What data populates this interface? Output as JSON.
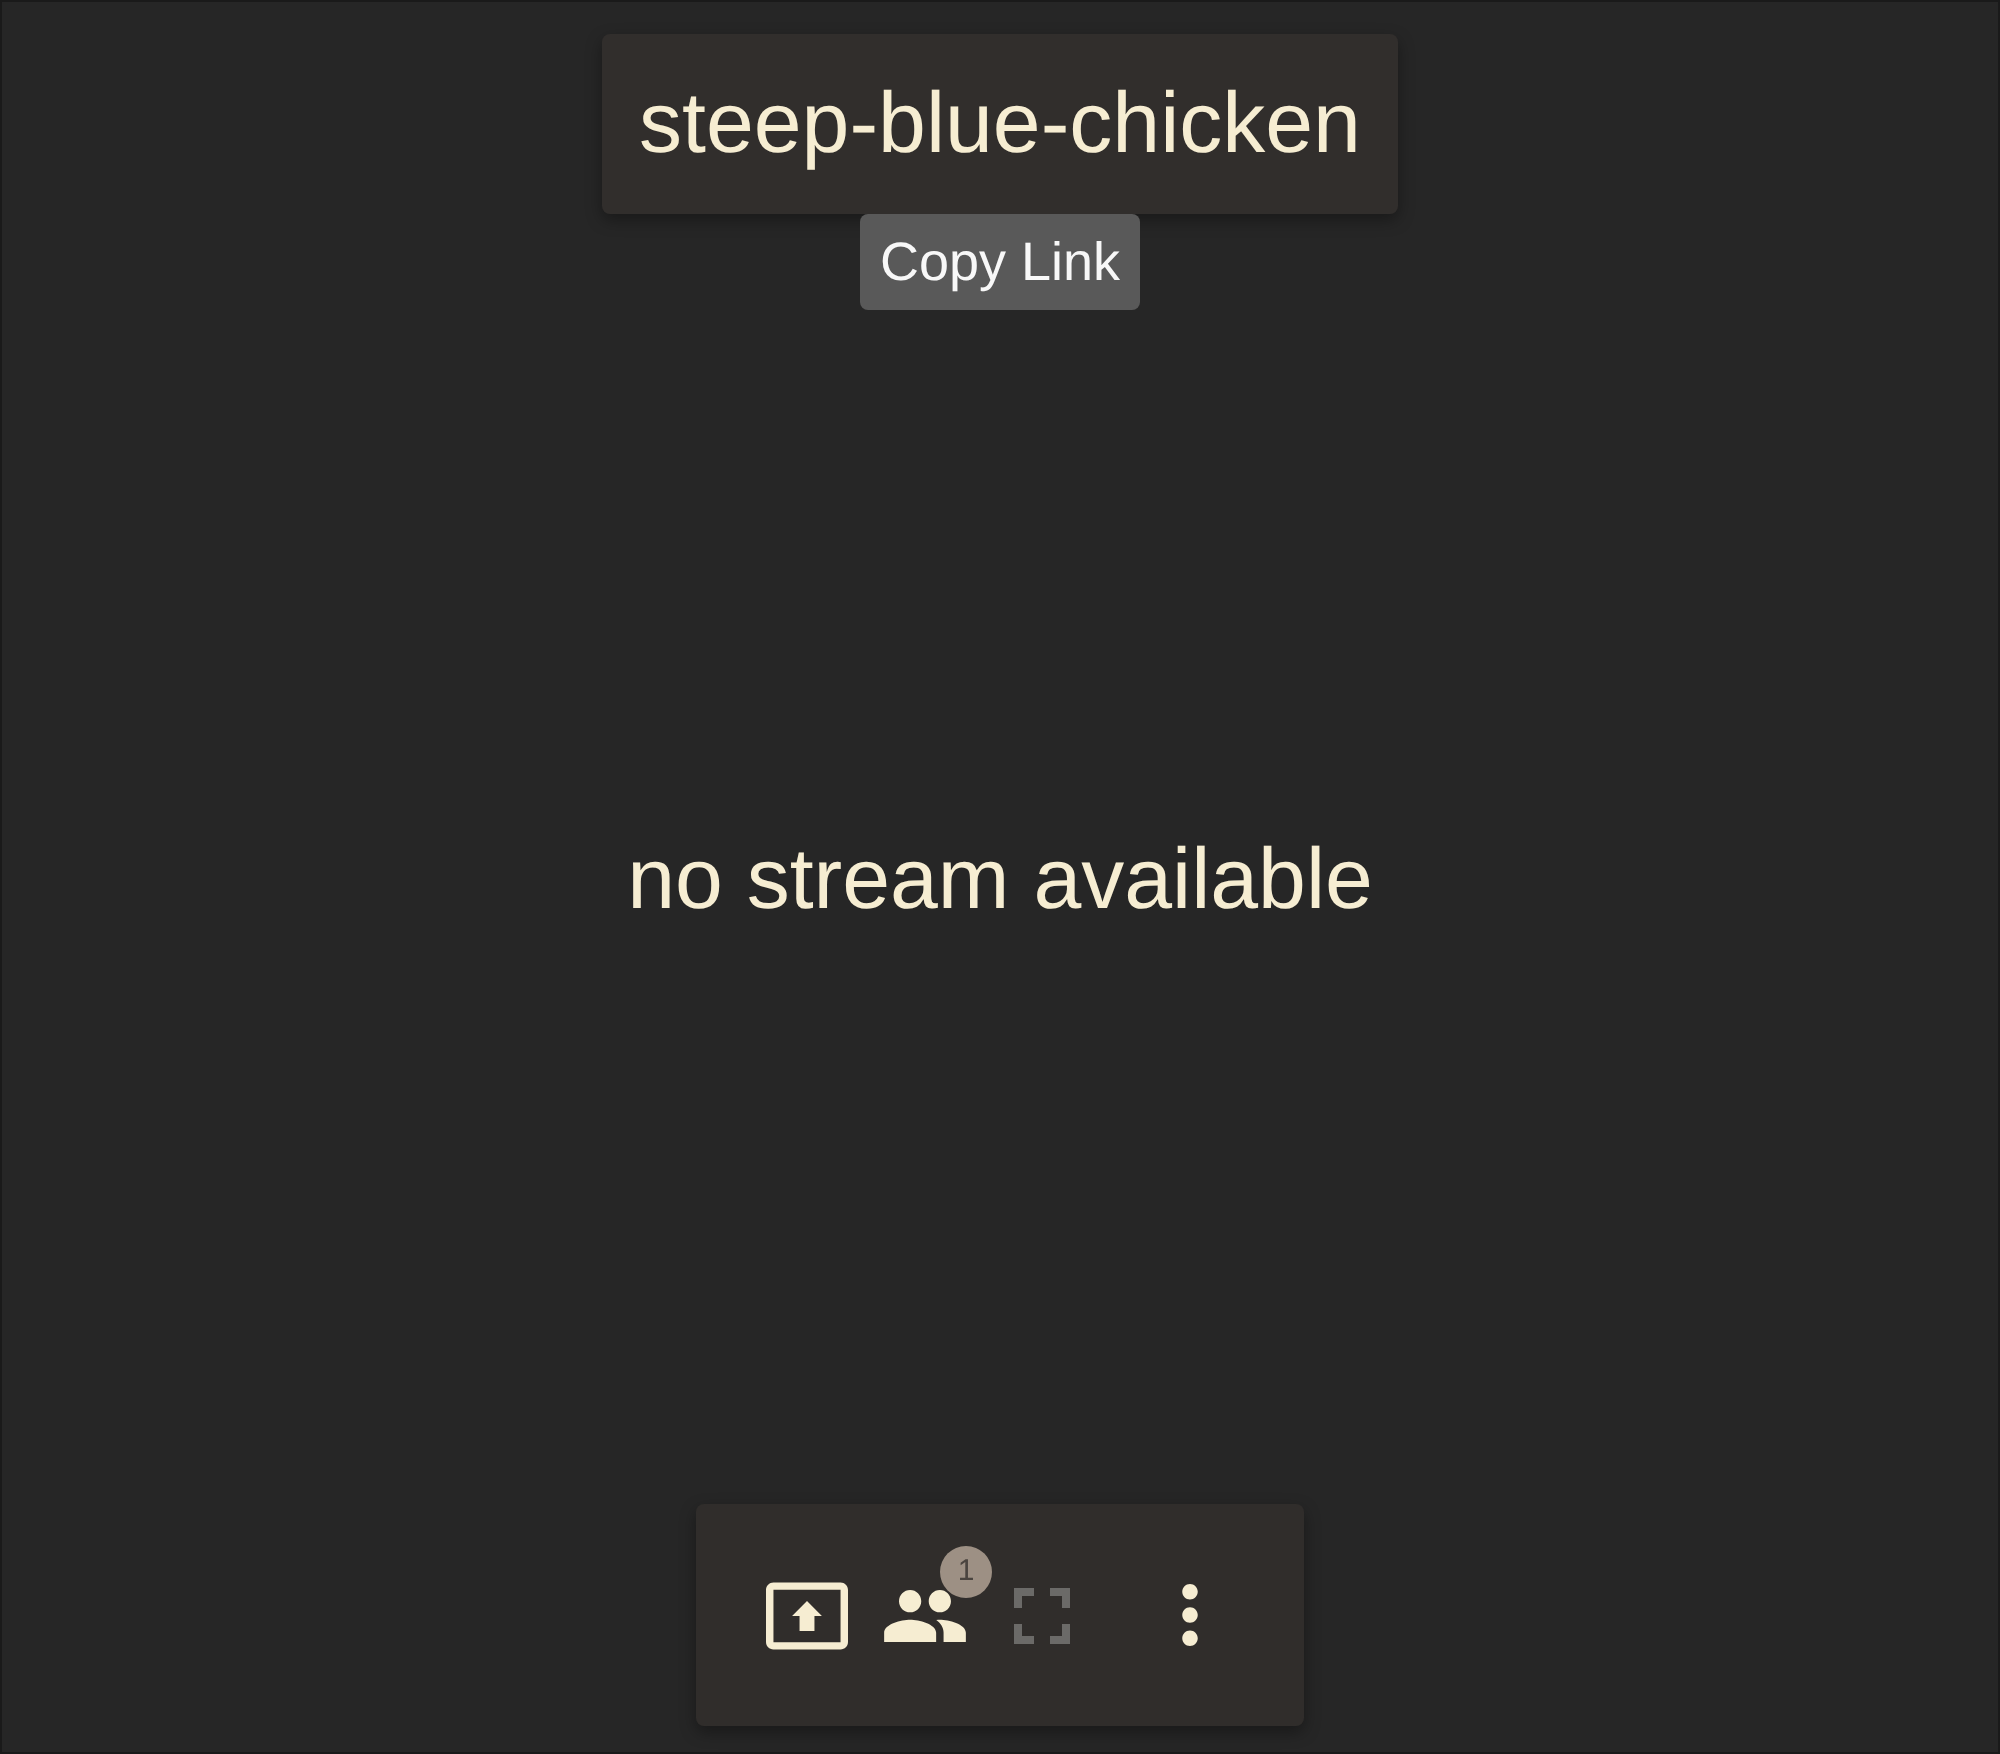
{
  "room": {
    "name": "steep-blue-chicken",
    "tooltip": "Copy Link"
  },
  "message": "no stream available",
  "toolbar": [
    {
      "kind": "share",
      "disabled": false
    },
    {
      "kind": "participants",
      "disabled": false,
      "badge": "1"
    },
    {
      "kind": "fullscreen",
      "disabled": true
    },
    {
      "kind": "menu",
      "disabled": false
    }
  ]
}
